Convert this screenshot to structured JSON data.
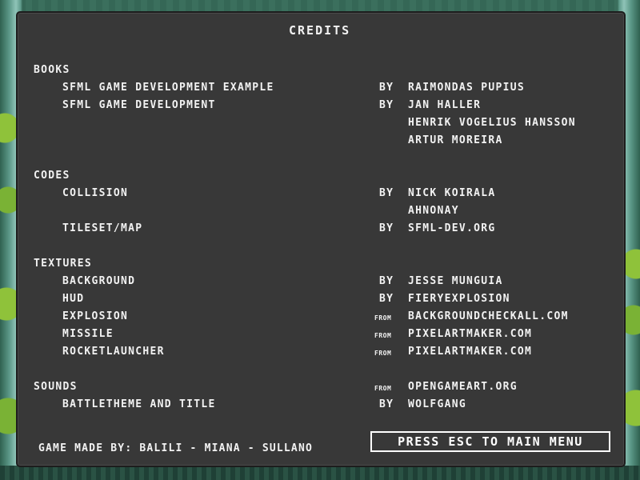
{
  "title": "CREDITS",
  "sections": {
    "books": {
      "heading": "BOOKS",
      "rows": [
        {
          "item": "SFML GAME DEVELOPMENT EXAMPLE",
          "conn": "BY",
          "who": "RAIMONDAS PUPIUS"
        },
        {
          "item": "SFML GAME DEVELOPMENT",
          "conn": "BY",
          "who": "JAN HALLER"
        },
        {
          "item": "",
          "conn": "",
          "who": "HENRIK VOGELIUS HANSSON"
        },
        {
          "item": "",
          "conn": "",
          "who": "ARTUR MOREIRA"
        }
      ]
    },
    "codes": {
      "heading": "CODES",
      "rows": [
        {
          "item": "COLLISION",
          "conn": "BY",
          "who": "NICK KOIRALA"
        },
        {
          "item": "",
          "conn": "",
          "who": "AHNONAY"
        },
        {
          "item": "TILESET/MAP",
          "conn": "BY",
          "who": "SFML-DEV.ORG"
        }
      ]
    },
    "textures": {
      "heading": "TEXTURES",
      "rows": [
        {
          "item": "BACKGROUND",
          "conn": "BY",
          "who": "JESSE MUNGUIA"
        },
        {
          "item": "HUD",
          "conn": "BY",
          "who": "FIERYEXPLOSION"
        },
        {
          "item": "EXPLOSION",
          "conn": "FROM",
          "who": "BACKGROUNDCHECKALL.COM"
        },
        {
          "item": "MISSILE",
          "conn": "FROM",
          "who": "PIXELARTMAKER.COM"
        },
        {
          "item": "ROCKETLAUNCHER",
          "conn": "FROM",
          "who": "PIXELARTMAKER.COM"
        }
      ]
    },
    "sounds": {
      "heading": "SOUNDS",
      "heading_conn": "FROM",
      "heading_who": "OPENGAMEART.ORG",
      "rows": [
        {
          "item": "BATTLETHEME AND TITLE",
          "conn": "BY",
          "who": "WOLFGANG"
        }
      ]
    }
  },
  "footer": {
    "made_by": "GAME MADE BY: BALILI - MIANA - SULLANO",
    "esc_button": "PRESS ESC TO MAIN MENU"
  }
}
